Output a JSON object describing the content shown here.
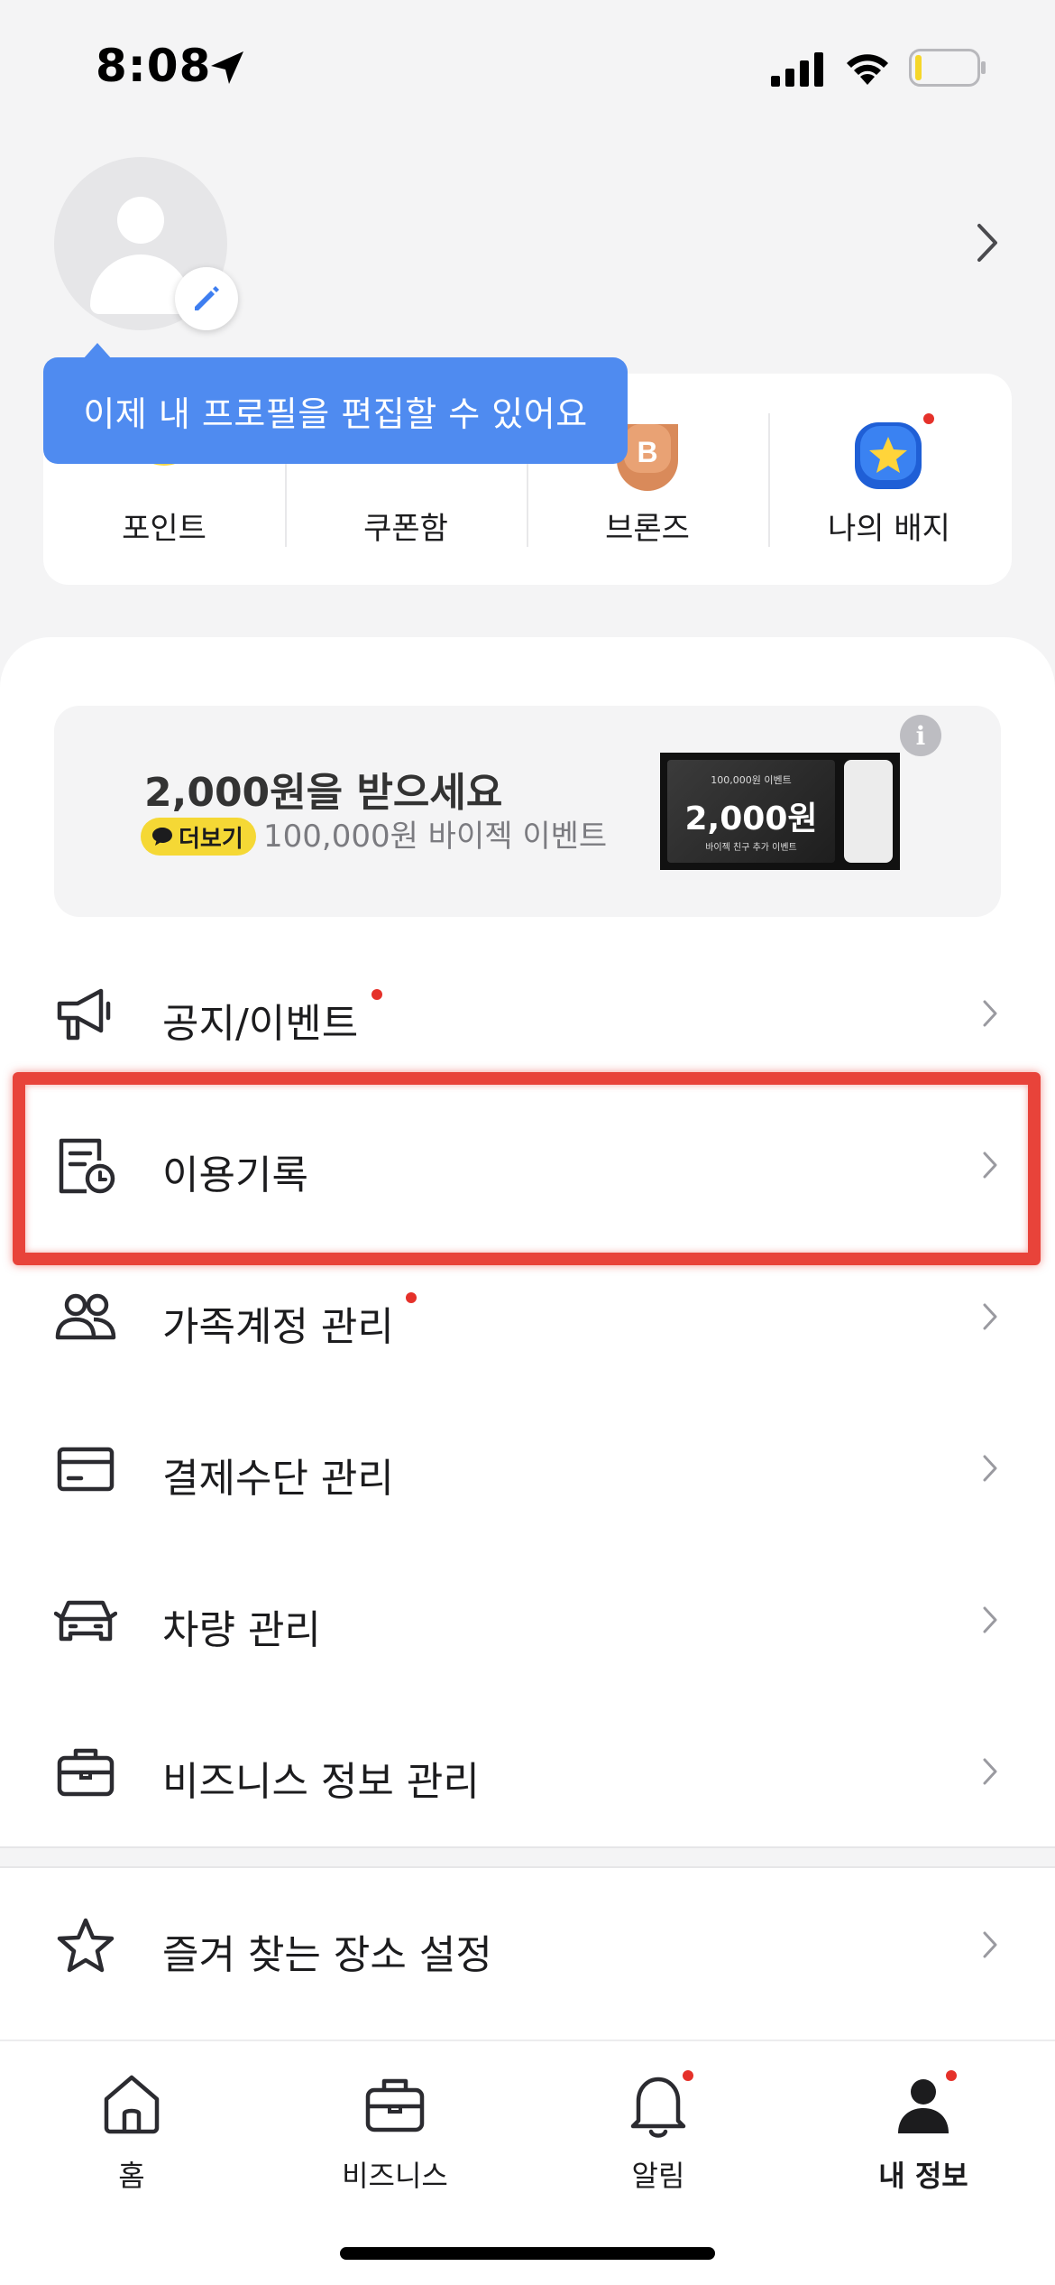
{
  "status_bar": {
    "time": "8:08"
  },
  "profile": {
    "tooltip": "이제 내 프로필을 편집할 수 있어요"
  },
  "quick_menu": [
    {
      "label": "포인트",
      "icon": "coin-icon"
    },
    {
      "label": "쿠폰함",
      "icon": "coupon-icon"
    },
    {
      "label": "브론즈",
      "icon": "bronze-grade-icon",
      "badge_letter": "B"
    },
    {
      "label": "나의 배지",
      "icon": "star-badge-icon",
      "has_dot": true
    }
  ],
  "banner": {
    "title": "2,000원을 받으세요",
    "more_label": "더보기",
    "subtitle": "100,000원 바이젝 이벤트",
    "ticket_top": "100,000원 이벤트",
    "ticket_amount": "2,000원",
    "ticket_bottom": "바이젝 친구 추가 이벤트",
    "info_icon": "i"
  },
  "menu": [
    {
      "label": "공지/이벤트",
      "icon": "megaphone-icon",
      "has_dot": true
    },
    {
      "label": "이용기록",
      "icon": "usage-history-icon",
      "has_dot": false,
      "highlighted": true
    },
    {
      "label": "가족계정 관리",
      "icon": "family-icon",
      "has_dot": true
    },
    {
      "label": "결제수단 관리",
      "icon": "card-icon",
      "has_dot": false
    },
    {
      "label": "차량 관리",
      "icon": "car-icon",
      "has_dot": false
    },
    {
      "label": "비즈니스 정보 관리",
      "icon": "briefcase-icon",
      "has_dot": false
    },
    {
      "label": "즐겨 찾는 장소 설정",
      "icon": "star-icon",
      "has_dot": false
    }
  ],
  "bottom_nav": [
    {
      "label": "홈",
      "icon": "home-icon",
      "active": false
    },
    {
      "label": "비즈니스",
      "icon": "briefcase-icon",
      "active": false
    },
    {
      "label": "알림",
      "icon": "bell-icon",
      "active": false,
      "has_dot": true
    },
    {
      "label": "내 정보",
      "icon": "person-icon",
      "active": true,
      "has_dot": true
    }
  ],
  "colors": {
    "accent_blue": "#4f8bf0",
    "notification_red": "#e5312a",
    "highlight_red": "#e8433a",
    "more_yellow": "#f5d835"
  }
}
